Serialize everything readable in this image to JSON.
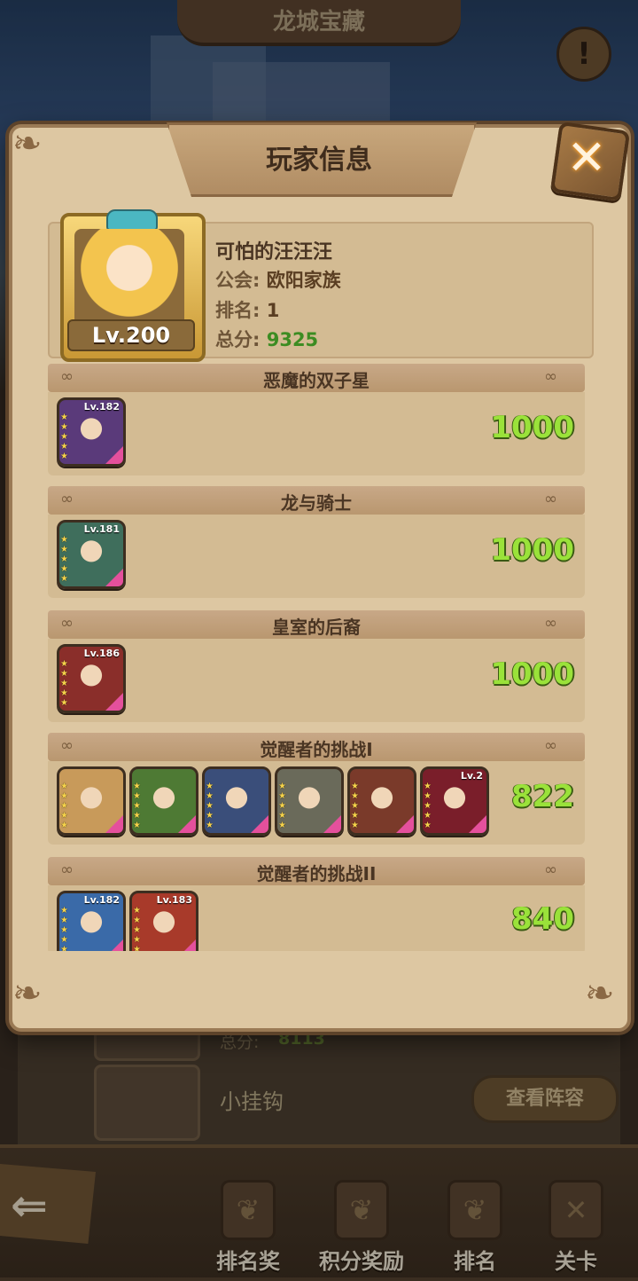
{
  "background": {
    "title": "龙城宝藏",
    "info_icon": "exclamation-icon",
    "behind_row_score_label": "总分:",
    "behind_row_score": "8113",
    "behind_row_name": "小挂钩",
    "view_lineup_label": "查看阵容"
  },
  "bottom_nav": {
    "back_icon": "back-arrow-icon",
    "items": [
      {
        "label": "排名奖",
        "icon": "rank-reward-icon"
      },
      {
        "label": "积分奖励",
        "icon": "points-reward-icon"
      },
      {
        "label": "排名",
        "icon": "ranking-icon"
      },
      {
        "label": "关卡",
        "icon": "stage-icon"
      }
    ]
  },
  "modal": {
    "title": "玩家信息",
    "close_icon": "close-icon",
    "player": {
      "name": "可怕的汪汪汪",
      "level": "Lv.200",
      "guild_label": "公会:",
      "guild": "欧阳家族",
      "rank_label": "排名:",
      "rank": "1",
      "total_label": "总分:",
      "total": "9325"
    },
    "sections": [
      {
        "title": "恶魔的双子星",
        "score": "1000",
        "heroes": [
          {
            "lv": "Lv.182",
            "color": "#5a3a7a"
          }
        ]
      },
      {
        "title": "龙与骑士",
        "score": "1000",
        "heroes": [
          {
            "lv": "Lv.181",
            "color": "#3f6e5c"
          }
        ]
      },
      {
        "title": "皇室的后裔",
        "score": "1000",
        "heroes": [
          {
            "lv": "Lv.186",
            "color": "#8a2e2a"
          }
        ]
      },
      {
        "title": "觉醒者的挑战I",
        "score": "822",
        "heroes": [
          {
            "lv": "",
            "color": "#c89a5a"
          },
          {
            "lv": "",
            "color": "#4e7a34"
          },
          {
            "lv": "",
            "color": "#3a4e7a"
          },
          {
            "lv": "",
            "color": "#6a6a5a"
          },
          {
            "lv": "",
            "color": "#7a3a2a"
          },
          {
            "lv": "Lv.2",
            "color": "#7a1e2a"
          }
        ]
      },
      {
        "title": "觉醒者的挑战II",
        "score": "840",
        "heroes": [
          {
            "lv": "Lv.182",
            "color": "#3a6aa8"
          },
          {
            "lv": "Lv.183",
            "color": "#a83a2a"
          }
        ]
      }
    ]
  },
  "colors": {
    "score_green": "#9ae23a",
    "total_green": "#3c8c22",
    "panel": "#ddc7a2"
  }
}
